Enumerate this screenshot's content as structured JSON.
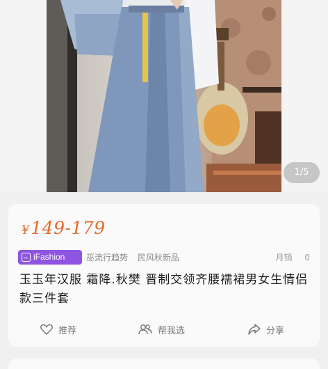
{
  "gallery": {
    "counter": "1/5"
  },
  "product": {
    "currency": "¥",
    "price_range": "149-179",
    "badge_label": "iFashion",
    "tags": [
      "巫流行趋势",
      "民风秋新品"
    ],
    "sales_label": "月销",
    "sales_count": "0",
    "title": "玉玉年汉服 霜降.秋樊 晋制交领齐腰襦裙男女生情侣款三件套"
  },
  "actions": {
    "recommend": "推荐",
    "help_choose": "帮我选",
    "share": "分享"
  },
  "colors": {
    "price": "#e8692a",
    "badge": "#8e56e0"
  }
}
